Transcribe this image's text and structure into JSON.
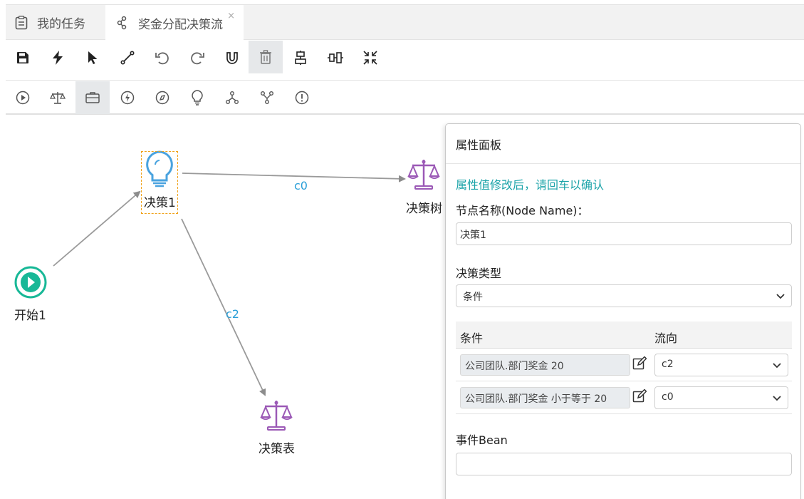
{
  "tabs": [
    {
      "label": "我的任务",
      "icon": "task-list-icon"
    },
    {
      "label": "奖金分配决策流",
      "icon": "flow-icon",
      "close": "×"
    }
  ],
  "toolbar_main": [
    {
      "name": "save-button",
      "icon": "save-icon"
    },
    {
      "name": "run-button",
      "icon": "lightning-icon"
    },
    {
      "name": "select-tool-button",
      "icon": "pointer-icon"
    },
    {
      "name": "connect-tool-button",
      "icon": "line-icon"
    },
    {
      "name": "undo-button",
      "icon": "undo-icon"
    },
    {
      "name": "redo-button",
      "icon": "redo-icon"
    },
    {
      "name": "magnet-button",
      "icon": "magnet-icon"
    },
    {
      "name": "delete-button",
      "icon": "trash-icon",
      "active": true
    },
    {
      "name": "align-vertical-button",
      "icon": "align-vertical-icon"
    },
    {
      "name": "align-horizontal-button",
      "icon": "align-horizontal-icon"
    },
    {
      "name": "shrink-button",
      "icon": "shrink-icon"
    }
  ],
  "toolbar_nodes": [
    {
      "name": "start-node-tool",
      "icon": "play-circle-icon"
    },
    {
      "name": "decision-table-tool",
      "icon": "scale-icon"
    },
    {
      "name": "action-tool",
      "icon": "briefcase-icon",
      "active": true
    },
    {
      "name": "event-tool",
      "icon": "lightning-circle-icon"
    },
    {
      "name": "script-tool",
      "icon": "compass-icon"
    },
    {
      "name": "decision-tool",
      "icon": "bulb-icon"
    },
    {
      "name": "fork-tool",
      "icon": "fork-icon"
    },
    {
      "name": "join-tool",
      "icon": "join-icon"
    },
    {
      "name": "end-tool",
      "icon": "alert-circle-icon"
    }
  ],
  "canvas": {
    "nodes": {
      "start": "开始1",
      "decision": "决策1",
      "tree": "决策树",
      "table": "决策表"
    },
    "edges": {
      "c0": "c0",
      "c2": "c2"
    }
  },
  "panel": {
    "title": "属性面板",
    "hint": "属性值修改后，请回车以确认",
    "node_name_label": "节点名称(Node Name)：",
    "node_name_value": "决策1",
    "decision_type_label": "决策类型",
    "decision_type_value": "条件",
    "table_headers": {
      "condition": "条件",
      "flow": "流向"
    },
    "rows": [
      {
        "condition": "公司团队.部门奖金  20",
        "flow": "c2"
      },
      {
        "condition": "公司团队.部门奖金 小于等于 20",
        "flow": "c0"
      }
    ],
    "event_bean_label": "事件Bean",
    "event_bean_value": ""
  },
  "colors": {
    "accent_teal": "#1aa3a8",
    "start_green": "#18b897",
    "decision_blue": "#4aa3df",
    "table_purple": "#9b59b6",
    "edge_label_blue": "#2a9fd8",
    "selection_orange": "#f0a31c"
  }
}
